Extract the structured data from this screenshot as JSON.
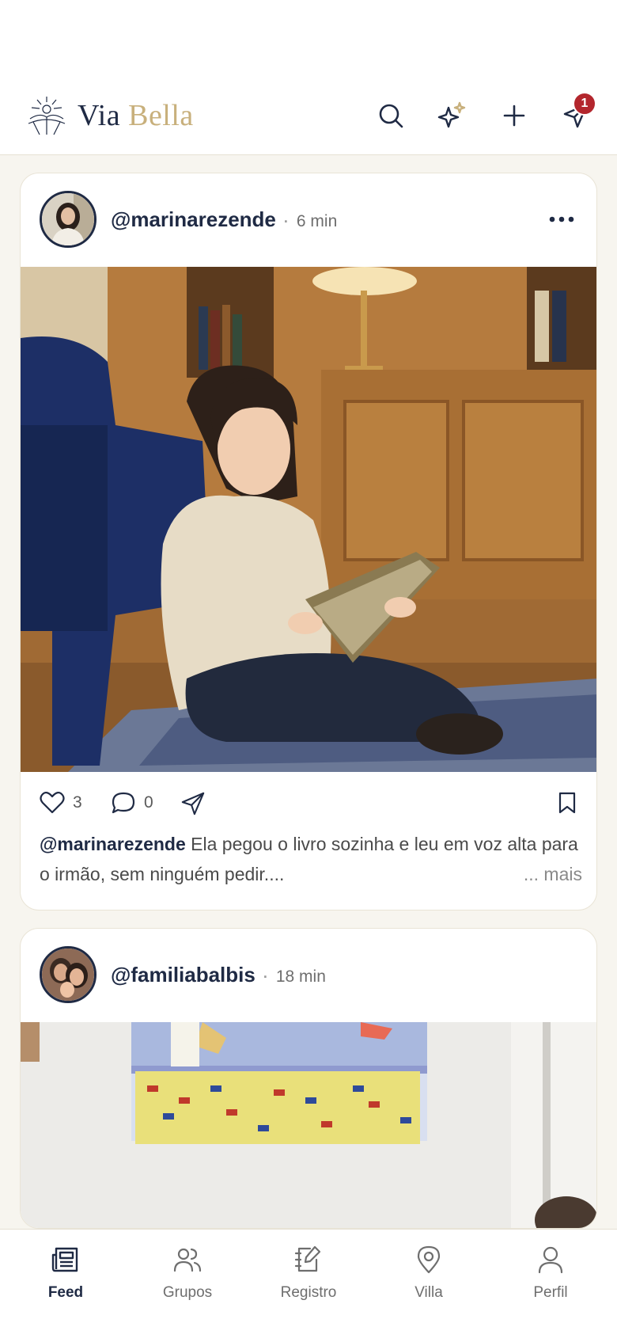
{
  "app": {
    "brand_part1": "Via",
    "brand_part2": "Bella",
    "accent": "#c8b07c",
    "primary": "#1f2a44",
    "badge_color": "#b3262d"
  },
  "topbar": {
    "icons": [
      "search-icon",
      "sparkles-icon",
      "plus-icon",
      "send-icon"
    ],
    "notification_count": "1"
  },
  "posts": [
    {
      "username": "@marinarezende",
      "time": "6 min",
      "likes": "3",
      "comments": "0",
      "caption_user": "@marinarezende",
      "caption_text": " Ela pegou o livro sozinha e leu em voz alta para o irmão, sem ninguém pedir....",
      "more_label": "... mais"
    },
    {
      "username": "@familiabalbis",
      "time": "18 min"
    }
  ],
  "nav": {
    "items": [
      {
        "label": "Feed",
        "icon": "newspaper-icon",
        "active": true
      },
      {
        "label": "Grupos",
        "icon": "users-icon"
      },
      {
        "label": "Registro",
        "icon": "edit-note-icon"
      },
      {
        "label": "Villa",
        "icon": "map-pin-icon"
      },
      {
        "label": "Perfil",
        "icon": "user-icon"
      }
    ]
  }
}
